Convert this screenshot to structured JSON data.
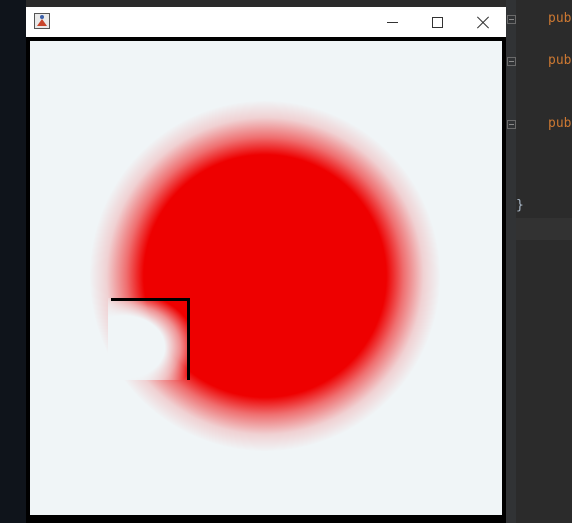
{
  "window": {
    "title": "",
    "icon": "java-app-icon",
    "controls": {
      "minimize": "minimize-icon",
      "maximize": "maximize-icon",
      "close": "close-icon"
    }
  },
  "canvas": {
    "background_color": "#f0f5f7",
    "blob_color": "#ee0000",
    "border_color": "#000000",
    "wall_color": "#000000"
  },
  "editor": {
    "keywords": [
      "pub",
      "pub",
      "pub"
    ],
    "closing_brace": "}",
    "keyword_color": "#cc7832"
  }
}
